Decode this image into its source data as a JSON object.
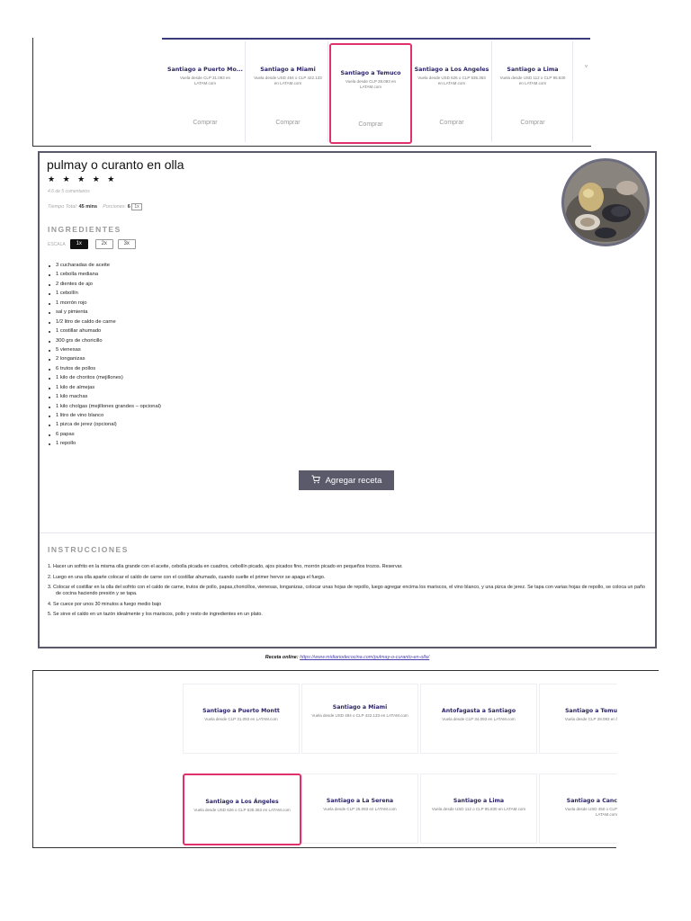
{
  "top_ad": {
    "flights": [
      {
        "title": "Santiago a Puerto Mo...",
        "sub": "Vuela desde CLP 31.093 en LATAM.com",
        "cta": "Comprar",
        "selected": false
      },
      {
        "title": "Santiago a Miami",
        "sub": "Vuela desde USD 494 o CLP 422.133 en LATAM.com",
        "cta": "Comprar",
        "selected": false
      },
      {
        "title": "Santiago a Temuco",
        "sub": "Vuela desde CLP 28.093 en LATAM.com",
        "cta": "Comprar",
        "selected": true
      },
      {
        "title": "Santiago a Los Ángeles",
        "sub": "Vuela desde USD 626 o CLP 535.363 en LATAM.com",
        "cta": "Comprar",
        "selected": false
      },
      {
        "title": "Santiago a Lima",
        "sub": "Vuela desde USD 112 o CLP 95.830 en LATAM.com",
        "cta": "Comprar",
        "selected": false
      },
      {
        "title": "",
        "sub": "V",
        "cta": "",
        "selected": false
      }
    ]
  },
  "recipe": {
    "title": "pulmay o curanto en olla",
    "stars": "★ ★ ★ ★ ★",
    "rating_text": "4.6 de 5 comentarios",
    "time_label": "Tiempo Total:",
    "time_value": "45 mins",
    "portions_label": "Porciones:",
    "portions_value": "6",
    "portions_btn": "1x",
    "ingredients_heading": "INGREDIENTES",
    "scale_label": "ESCALA",
    "scale_options": [
      "1x",
      "2x",
      "3x"
    ],
    "ingredients": [
      "3 cucharadas de aceite",
      "1 cebolla mediana",
      "2 dientes de ajo",
      "1 cebollín",
      "1 morrón rojo",
      "sal y pimienta",
      "1/2 litro de caldo de carne",
      "1 costillar ahumado",
      "300 grs de choricillo",
      "5 vienesas",
      "2 longanizas",
      "6 trutos de pollos",
      "1 kilo de choritos (mejillones)",
      "1 kilo de almejas",
      "1 kilo machas",
      "1 kilo cholgas (mejillones grandes – opcional)",
      "1 litro de vino blanco",
      "1 pizca de jerez (opcional)",
      "6 papas",
      "1 repollo"
    ],
    "add_button": "Agregar receta",
    "instructions_heading": "INSTRUCCIONES",
    "steps": [
      "1. Hacer un sofrito en la misma olla grande con el aceite, cebolla picada en cuadros, cebollín picado, ajos picados fino, morrón picado en pequeños trozos. Reservar.",
      "2. Luego en una olla aparte colocar el caldo de carne con el costillar ahumado, cuando suelte el primer hervor se apaga el fuego.",
      "3. Colocar el costillar en la olla del sofrito con el caldo de carne, trutos de pollo, papas,choricillos, vienesas, longanizas, colocar unas hojas de repollo, luego agregar encima los mariscos, el vino blanco, y una pizca de jerez. Se tapa con varias hojas de repollo, se coloca un paño de cocina haciendo presión y se tapa.",
      "4. Se cuece por unos 30 minutos a fuego medio bajo",
      "5. Se sirve el caldo en un tazón idealmente y los mariscos, pollo y resto de ingredientes en un plato."
    ],
    "online_label": "Receta online",
    "online_url": "https://www.midiariodecocina.com/pulmay-o-curanto-en-olla/"
  },
  "bottom_ad": {
    "flights": [
      {
        "title": "Santiago a Puerto Montt",
        "sub": "Vuela desde CLP 31.093 en LATAM.com",
        "selected": false
      },
      {
        "title": "Santiago a Miami",
        "sub": "Vuela desde USD 494 o CLP 422.133 en LATAM.com",
        "selected": false
      },
      {
        "title": "Antofagasta a Santiago",
        "sub": "Vuela desde CLP 34.093 en LATAM.com",
        "selected": false
      },
      {
        "title": "Santiago a Temu",
        "sub": "Vuela desde CLP 28.093 en l",
        "selected": false
      },
      {
        "title": "Santiago a Los Ángeles",
        "sub": "Vuela desde USD 626 o CLP 535.363 en LATAM.com",
        "selected": true
      },
      {
        "title": "Santiago a La Serena",
        "sub": "Vuela desde CLP 25.093 en LATAM.com",
        "selected": false
      },
      {
        "title": "Santiago a Lima",
        "sub": "Vuela desde USD 112 o CLP 95.830 en LATAM.com",
        "selected": false
      },
      {
        "title": "Santiago a Canc",
        "sub": "Vuela desde USD 450 o CLP LATAM.com",
        "selected": false
      }
    ]
  },
  "colors": {
    "accent": "#e0316c",
    "brand": "#2b2464",
    "button": "#5a5a6b"
  }
}
